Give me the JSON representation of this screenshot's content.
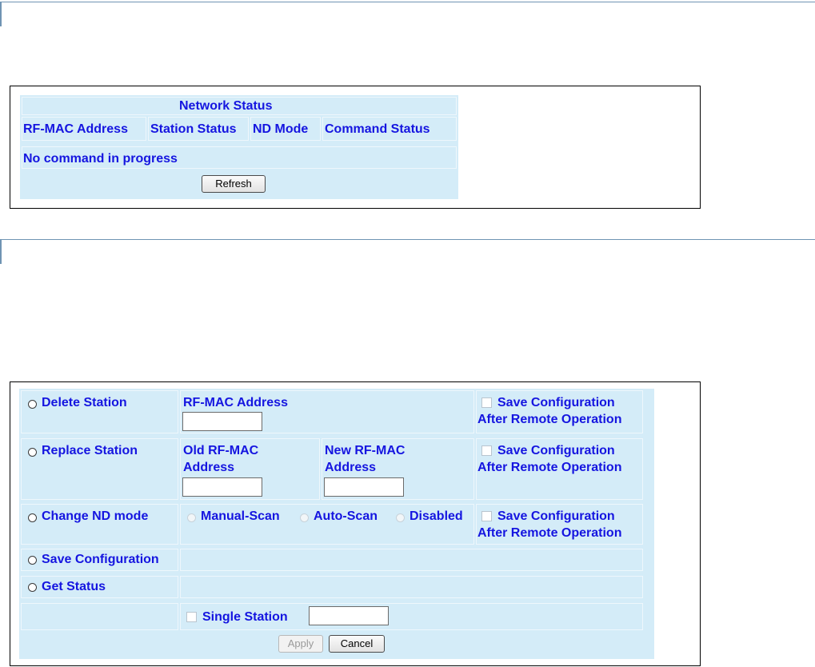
{
  "network_status": {
    "title": "Network Status",
    "columns": [
      "RF-MAC Address",
      "Station Status",
      "ND Mode",
      "Command Status"
    ],
    "message": "No command in progress",
    "refresh_label": "Refresh"
  },
  "commands": {
    "delete_station": {
      "label": "Delete Station",
      "field_label": "RF-MAC Address",
      "field_value": "",
      "save_label_1": "Save Configuration",
      "save_label_2": "After Remote Operation"
    },
    "replace_station": {
      "label": "Replace Station",
      "old_label_1": "Old RF-MAC",
      "old_label_2": "Address",
      "old_value": "",
      "new_label_1": "New RF-MAC",
      "new_label_2": "Address",
      "new_value": "",
      "save_label_1": "Save Configuration",
      "save_label_2": "After Remote Operation"
    },
    "change_nd_mode": {
      "label": "Change ND mode",
      "options": [
        "Manual-Scan",
        "Auto-Scan",
        "Disabled"
      ],
      "save_label_1": "Save Configuration",
      "save_label_2": "After Remote Operation"
    },
    "save_configuration": {
      "label": "Save Configuration"
    },
    "get_status": {
      "label": "Get Status"
    },
    "single_station": {
      "label": "Single Station",
      "value": ""
    },
    "apply_label": "Apply",
    "cancel_label": "Cancel"
  }
}
